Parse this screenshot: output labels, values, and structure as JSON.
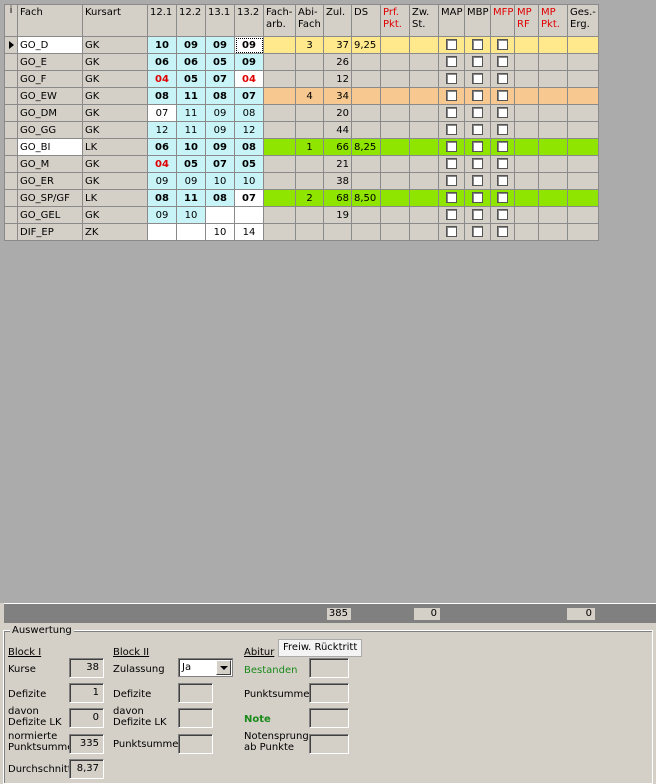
{
  "grid": {
    "indicator_header": "i",
    "headers": {
      "fach": "Fach",
      "kursart": "Kursart",
      "h121": "12.1",
      "h122": "12.2",
      "h131": "13.1",
      "h132": "13.2",
      "facharb": "Fach-\narb.",
      "abifach": "Abi-\nFach",
      "zul": "Zul.",
      "ds": "DS",
      "prfpkt": "Prf.\nPkt.",
      "zwst": "Zw.\nSt.",
      "map": "MAP",
      "mbp": "MBP",
      "mfp": "MFP",
      "mprf": "MP\nRF",
      "mppkt": "MP\nPkt.",
      "geserg": "Ges.-\nErg."
    },
    "rows": [
      {
        "fach": "GO_D",
        "kursart": "GK",
        "g121": "10",
        "g122": "09",
        "g131": "09",
        "g132": "09",
        "abifach": "3",
        "zul": "37",
        "ds": "9,25"
      },
      {
        "fach": "GO_E",
        "kursart": "GK",
        "g121": "06",
        "g122": "06",
        "g131": "05",
        "g132": "09",
        "abifach": "",
        "zul": "26",
        "ds": ""
      },
      {
        "fach": "GO_F",
        "kursart": "GK",
        "g121": "04",
        "g122": "05",
        "g131": "07",
        "g132": "04",
        "abifach": "",
        "zul": "12",
        "ds": ""
      },
      {
        "fach": "GO_EW",
        "kursart": "GK",
        "g121": "08",
        "g122": "11",
        "g131": "08",
        "g132": "07",
        "abifach": "4",
        "zul": "34",
        "ds": ""
      },
      {
        "fach": "GO_DM",
        "kursart": "GK",
        "g121": "07",
        "g122": "11",
        "g131": "09",
        "g132": "08",
        "abifach": "",
        "zul": "20",
        "ds": ""
      },
      {
        "fach": "GO_GG",
        "kursart": "GK",
        "g121": "12",
        "g122": "11",
        "g131": "09",
        "g132": "12",
        "abifach": "",
        "zul": "44",
        "ds": ""
      },
      {
        "fach": "GO_BI",
        "kursart": "LK",
        "g121": "06",
        "g122": "10",
        "g131": "09",
        "g132": "08",
        "abifach": "1",
        "zul": "66",
        "ds": "8,25"
      },
      {
        "fach": "GO_M",
        "kursart": "GK",
        "g121": "04",
        "g122": "05",
        "g131": "07",
        "g132": "05",
        "abifach": "",
        "zul": "21",
        "ds": ""
      },
      {
        "fach": "GO_ER",
        "kursart": "GK",
        "g121": "09",
        "g122": "09",
        "g131": "10",
        "g132": "10",
        "abifach": "",
        "zul": "38",
        "ds": ""
      },
      {
        "fach": "GO_SP/GF",
        "kursart": "LK",
        "g121": "08",
        "g122": "11",
        "g131": "08",
        "g132": "07",
        "abifach": "2",
        "zul": "68",
        "ds": "8,50"
      },
      {
        "fach": "GO_GEL",
        "kursart": "GK",
        "g121": "09",
        "g122": "10",
        "g131": "",
        "g132": "",
        "abifach": "",
        "zul": "19",
        "ds": ""
      },
      {
        "fach": "DIF_EP",
        "kursart": "ZK",
        "g121": "",
        "g122": "",
        "g131": "10",
        "g132": "14",
        "abifach": "",
        "zul": "",
        "ds": ""
      }
    ]
  },
  "sums": {
    "zul": "385",
    "zwst": "0",
    "geserg": "0"
  },
  "colors": {
    "yellow": "#ffe98c",
    "orange": "#f7c88f",
    "green": "#8fe400",
    "cyan": "#c8f4f8",
    "red": "#e00000"
  },
  "panel": {
    "title": "Auswertung",
    "block1": {
      "title": "Block I",
      "kurse_label": "Kurse",
      "kurse_value": "38",
      "defizite_label": "Defizite",
      "defizite_value": "1",
      "defizite_lk_label": "davon\nDefizite LK",
      "defizite_lk_value": "0",
      "punktsumme_label": "normierte\nPunktsumme",
      "punktsumme_value": "335",
      "durchschnitt_label": "Durchschnitt",
      "durchschnitt_value": "8,37"
    },
    "block2": {
      "title": "Block II",
      "zulassung_label": "Zulassung",
      "zulassung_value": "Ja",
      "defizite_label": "Defizite",
      "defizite_lk_label": "davon\nDefizite LK",
      "punktsumme_label": "Punktsumme"
    },
    "abitur": {
      "title": "Abitur",
      "freiw_button": "Freiw. Rücktritt",
      "bestanden_label": "Bestanden",
      "punktsumme_label": "Punktsumme",
      "note_label": "Note",
      "notensprung_label": "Notensprung\nab Punkte"
    }
  }
}
